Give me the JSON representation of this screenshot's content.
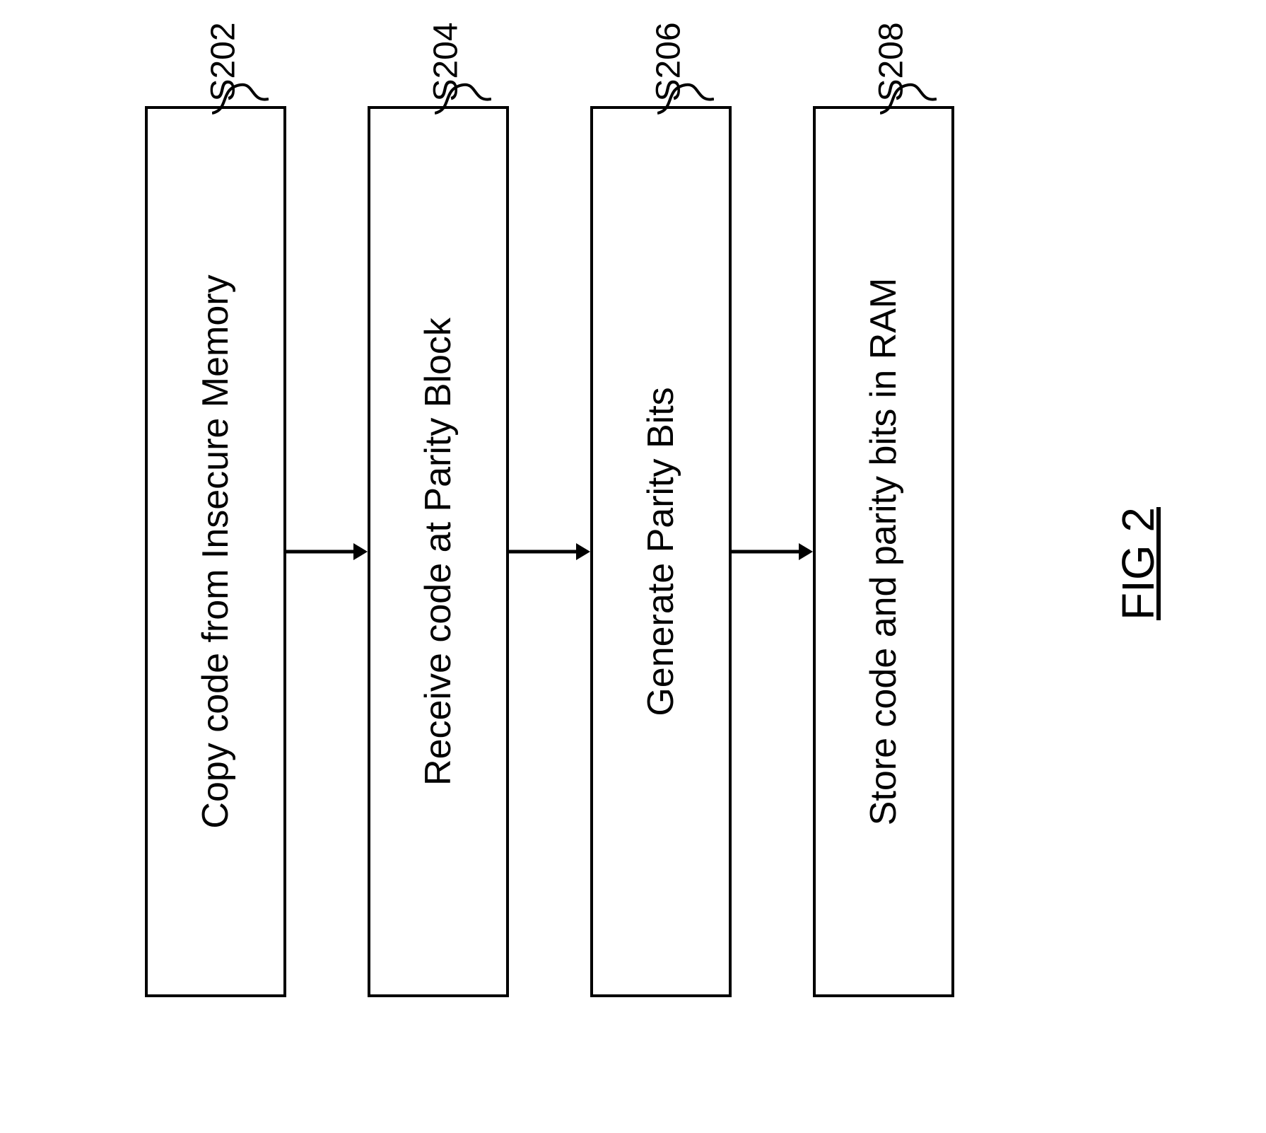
{
  "steps": [
    {
      "text": "Copy code from Insecure Memory",
      "label": "S202"
    },
    {
      "text": "Receive code at Parity Block",
      "label": "S204"
    },
    {
      "text": "Generate Parity Bits",
      "label": "S206"
    },
    {
      "text": "Store code and parity bits in RAM",
      "label": "S208"
    }
  ],
  "figure_label": "FIG 2"
}
